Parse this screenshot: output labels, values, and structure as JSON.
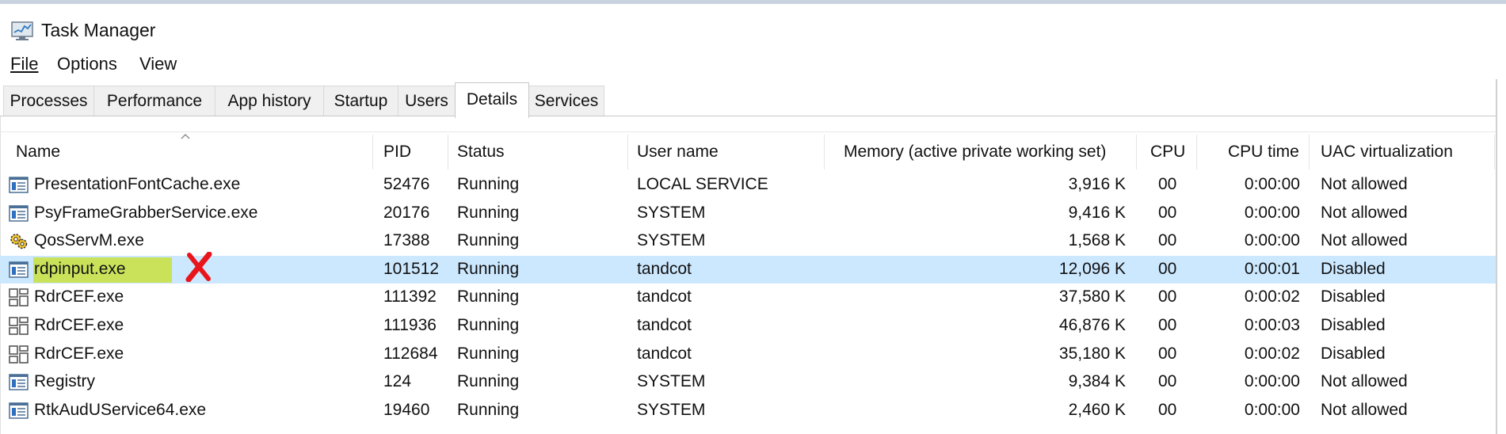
{
  "window": {
    "title": "Task Manager"
  },
  "icons": {
    "app": "task-manager-icon",
    "sort": "sort-ascending-icon",
    "mark": "red-x-mark-icon"
  },
  "menu": [
    {
      "label": "File"
    },
    {
      "label": "Options"
    },
    {
      "label": "View"
    }
  ],
  "tabs": [
    {
      "label": "Processes"
    },
    {
      "label": "Performance"
    },
    {
      "label": "App history"
    },
    {
      "label": "Startup"
    },
    {
      "label": "Users"
    },
    {
      "label": "Details"
    },
    {
      "label": "Services"
    }
  ],
  "active_tab": "Details",
  "columns": [
    {
      "label": "Name"
    },
    {
      "label": "PID"
    },
    {
      "label": "Status"
    },
    {
      "label": "User name"
    },
    {
      "label": "Memory (active private working set)"
    },
    {
      "label": "CPU"
    },
    {
      "label": "CPU time"
    },
    {
      "label": "UAC virtualization"
    }
  ],
  "rows": [
    {
      "icon": "process-window-icon",
      "name": "PresentationFontCache.exe",
      "pid": "52476",
      "status": "Running",
      "user": "LOCAL SERVICE",
      "memory": "3,916 K",
      "cpu": "00",
      "cpu_time": "0:00:00",
      "uac": "Not allowed"
    },
    {
      "icon": "process-window-icon",
      "name": "PsyFrameGrabberService.exe",
      "pid": "20176",
      "status": "Running",
      "user": "SYSTEM",
      "memory": "9,416 K",
      "cpu": "00",
      "cpu_time": "0:00:00",
      "uac": "Not allowed"
    },
    {
      "icon": "gear-service-icon",
      "name": "QosServM.exe",
      "pid": "17388",
      "status": "Running",
      "user": "SYSTEM",
      "memory": "1,568 K",
      "cpu": "00",
      "cpu_time": "0:00:00",
      "uac": "Not allowed"
    },
    {
      "icon": "process-window-icon",
      "name": "rdpinput.exe",
      "pid": "101512",
      "status": "Running",
      "user": "tandcot",
      "memory": "12,096 K",
      "cpu": "00",
      "cpu_time": "0:00:01",
      "uac": "Disabled",
      "selected": true
    },
    {
      "icon": "app-grid-icon",
      "name": "RdrCEF.exe",
      "pid": "111392",
      "status": "Running",
      "user": "tandcot",
      "memory": "37,580 K",
      "cpu": "00",
      "cpu_time": "0:00:02",
      "uac": "Disabled"
    },
    {
      "icon": "app-grid-icon",
      "name": "RdrCEF.exe",
      "pid": "111936",
      "status": "Running",
      "user": "tandcot",
      "memory": "46,876 K",
      "cpu": "00",
      "cpu_time": "0:00:03",
      "uac": "Disabled"
    },
    {
      "icon": "app-grid-icon",
      "name": "RdrCEF.exe",
      "pid": "112684",
      "status": "Running",
      "user": "tandcot",
      "memory": "35,180 K",
      "cpu": "00",
      "cpu_time": "0:00:02",
      "uac": "Disabled"
    },
    {
      "icon": "process-window-icon",
      "name": "Registry",
      "pid": "124",
      "status": "Running",
      "user": "SYSTEM",
      "memory": "9,384 K",
      "cpu": "00",
      "cpu_time": "0:00:00",
      "uac": "Not allowed"
    },
    {
      "icon": "process-window-icon",
      "name": "RtkAudUService64.exe",
      "pid": "19460",
      "status": "Running",
      "user": "SYSTEM",
      "memory": "2,460 K",
      "cpu": "00",
      "cpu_time": "0:00:00",
      "uac": "Not allowed"
    }
  ],
  "colors": {
    "selected_row": "#cce8ff",
    "highlight": "#c9e25a",
    "mark": "#e8161b"
  }
}
